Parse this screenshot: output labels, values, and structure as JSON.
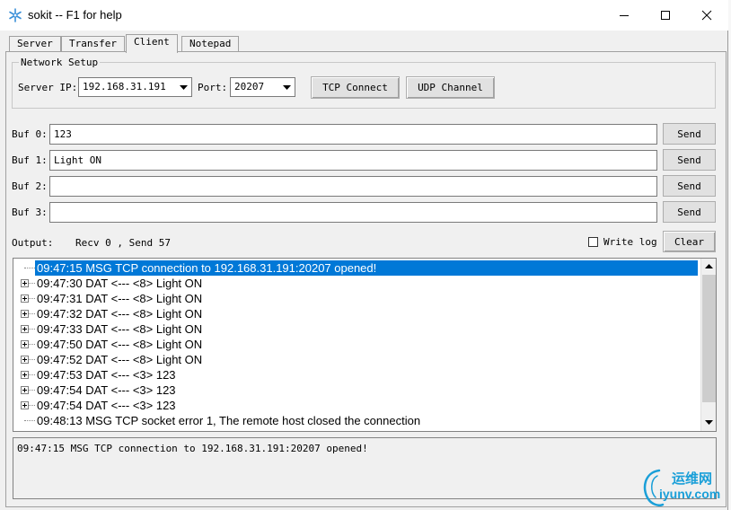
{
  "window": {
    "title": "sokit -- F1 for help"
  },
  "tabs": [
    {
      "label": "Server"
    },
    {
      "label": "Transfer"
    },
    {
      "label": "Client"
    },
    {
      "label": "Notepad"
    }
  ],
  "network": {
    "legend": "Network Setup",
    "server_ip_label": "Server IP:",
    "server_ip": "192.168.31.191",
    "port_label": "Port:",
    "port": "20207",
    "tcp_connect": "TCP Connect",
    "udp_channel": "UDP Channel"
  },
  "buffers": [
    {
      "label": "Buf 0:",
      "value": "123",
      "send": "Send"
    },
    {
      "label": "Buf 1:",
      "value": "Light ON",
      "send": "Send"
    },
    {
      "label": "Buf 2:",
      "value": "",
      "send": "Send"
    },
    {
      "label": "Buf 3:",
      "value": "",
      "send": "Send"
    }
  ],
  "output": {
    "label": "Output:",
    "stats": "Recv 0 , Send 57",
    "write_log": "Write log",
    "clear": "Clear"
  },
  "log": [
    {
      "text": "09:47:15 MSG TCP connection to 192.168.31.191:20207 opened!",
      "expandable": false,
      "selected": true
    },
    {
      "text": "09:47:30 DAT <--- <8> Light ON",
      "expandable": true,
      "selected": false
    },
    {
      "text": "09:47:31 DAT <--- <8> Light ON",
      "expandable": true,
      "selected": false
    },
    {
      "text": "09:47:32 DAT <--- <8> Light ON",
      "expandable": true,
      "selected": false
    },
    {
      "text": "09:47:33 DAT <--- <8> Light ON",
      "expandable": true,
      "selected": false
    },
    {
      "text": "09:47:50 DAT <--- <8> Light ON",
      "expandable": true,
      "selected": false
    },
    {
      "text": "09:47:52 DAT <--- <8> Light ON",
      "expandable": true,
      "selected": false
    },
    {
      "text": "09:47:53 DAT <--- <3> 123",
      "expandable": true,
      "selected": false
    },
    {
      "text": "09:47:54 DAT <--- <3> 123",
      "expandable": true,
      "selected": false
    },
    {
      "text": "09:47:54 DAT <--- <3> 123",
      "expandable": true,
      "selected": false
    },
    {
      "text": "09:48:13 MSG TCP socket error 1, The remote host closed the connection",
      "expandable": false,
      "selected": false
    }
  ],
  "detail": {
    "text": "09:47:15 MSG TCP connection to 192.168.31.191:20207 opened!"
  },
  "watermark": {
    "line1": "运维网",
    "line2": "iyunv.com"
  },
  "colors": {
    "selection": "#0078d7",
    "window_bg": "#f0f0f0",
    "watermark": "#1a9fd8"
  }
}
